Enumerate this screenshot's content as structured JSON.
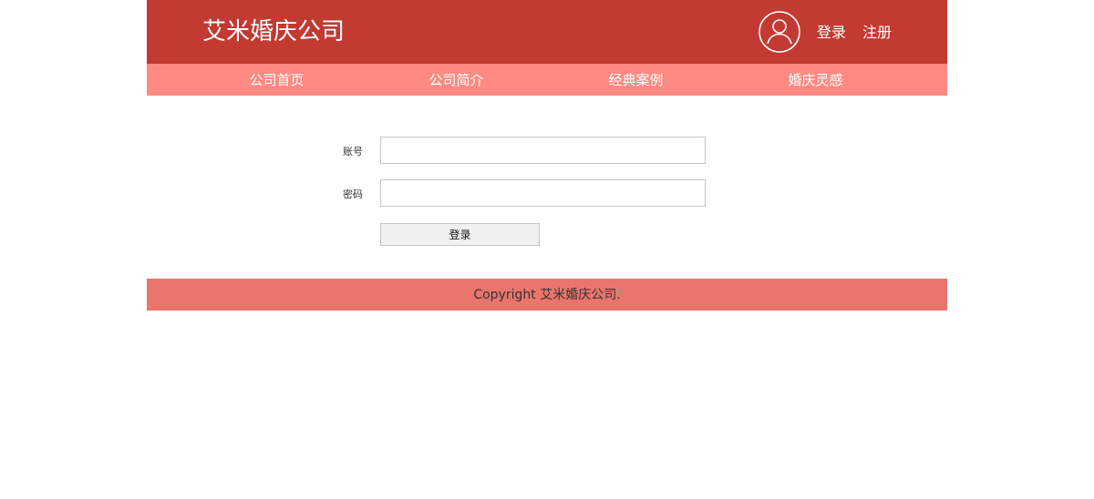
{
  "header": {
    "brand": "艾米婚庆公司",
    "avatar_icon": "user-avatar-icon",
    "login_label": "登录",
    "register_label": "注册",
    "bg_color": "#c23a31"
  },
  "nav": {
    "bg_color": "#fe8a82",
    "items": [
      {
        "label": "公司首页"
      },
      {
        "label": "公司简介"
      },
      {
        "label": "经典案例"
      },
      {
        "label": "婚庆灵感"
      }
    ]
  },
  "login_form": {
    "account_label": "账号",
    "account_value": "",
    "password_label": "密码",
    "password_value": "",
    "submit_label": "登录"
  },
  "footer": {
    "text": "Copyright 艾米婚庆公司.",
    "bg_color": "#ea756d"
  }
}
